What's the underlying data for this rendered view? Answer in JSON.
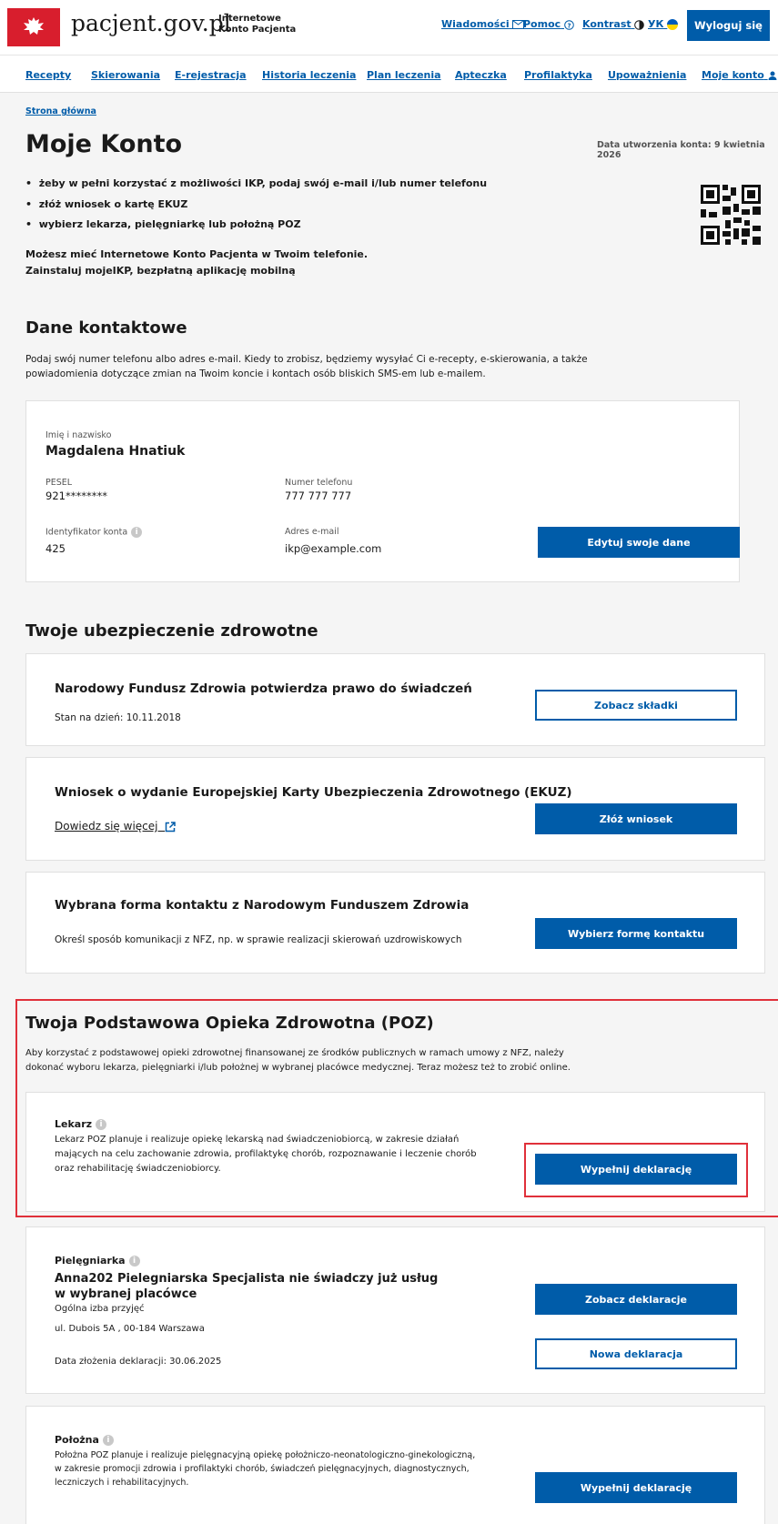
{
  "header": {
    "site_name": "pacjent.gov.pl",
    "subtitle_line1": "Internetowe",
    "subtitle_line2": "Konto Pacjenta",
    "messages": "Wiadomości",
    "help": "Pomoc",
    "contrast": "Kontrast",
    "lang": "УК",
    "logout": "Wyloguj się"
  },
  "nav": [
    {
      "label": "Recepty"
    },
    {
      "label": "Skierowania"
    },
    {
      "label": "E-rejestracja"
    },
    {
      "label": "Historia leczenia"
    },
    {
      "label": "Plan leczenia"
    },
    {
      "label": "Apteczka"
    },
    {
      "label": "Profilaktyka"
    },
    {
      "label": "Upoważnienia"
    },
    {
      "label": "Moje konto"
    }
  ],
  "breadcrumb": "Strona główna",
  "page_title": "Moje Konto",
  "created": "Data utworzenia konta: 9 kwietnia 2026",
  "bullets": [
    "żeby w pełni korzystać z możliwości IKP, podaj swój e-mail i/lub numer telefonu",
    "złóż wniosek o kartę EKUZ",
    "wybierz lekarza, pielęgniarkę lub położną POZ"
  ],
  "app_promo": {
    "line1": "Możesz mieć Internetowe Konto Pacjenta w Twoim telefonie.",
    "line2": "Zainstaluj mojeIKP, bezpłatną aplikację mobilną"
  },
  "contact": {
    "title": "Dane kontaktowe",
    "desc1": "Podaj swój numer telefonu albo adres e-mail. Kiedy to zrobisz, będziemy wysyłać Ci e-recepty, e-skierowania, a także",
    "desc2": "powiadomienia dotyczące zmian na Twoim koncie i kontach osób bliskich SMS-em lub e-mailem.",
    "name_label": "Imię i nazwisko",
    "name": "Magdalena Hnatiuk",
    "pesel_label": "PESEL",
    "pesel": "921********",
    "phone_label": "Numer telefonu",
    "phone": "777 777 777",
    "id_label": "Identyfikator konta",
    "id": "425",
    "email_label": "Adres e-mail",
    "email": "ikp@example.com",
    "edit_button": "Edytuj swoje dane"
  },
  "insurance": {
    "title": "Twoje ubezpieczenie zdrowotne",
    "nfz_title": "Narodowy Fundusz Zdrowia potwierdza prawo do świadczeń",
    "nfz_date": "Stan na dzień: 10.11.2018",
    "nfz_button": "Zobacz składki",
    "ekuz_title": "Wniosek o wydanie Europejskiej Karty Ubezpieczenia Zdrowotnego (EKUZ)",
    "ekuz_link": "Dowiedz się więcej",
    "ekuz_button": "Złóż wniosek",
    "form_title": "Wybrana forma kontaktu z Narodowym Funduszem Zdrowia",
    "form_text": "Określ sposób komunikacji z NFZ, np. w sprawie realizacji skierowań uzdrowiskowych",
    "form_button": "Wybierz formę kontaktu"
  },
  "poz": {
    "title": "Twoja Podstawowa Opieka Zdrowotna (POZ)",
    "desc1": "Aby korzystać z podstawowej opieki zdrowotnej finansowanej ze środków publicznych w ramach umowy z NFZ, należy",
    "desc2": "dokonać wyboru lekarza, pielęgniarki i/lub położnej w wybranej placówce medycznej. Teraz możesz też to zrobić online.",
    "doctor_label": "Lekarz",
    "doctor_text1": "Lekarz POZ planuje i realizuje opiekę lekarską nad świadczeniobiorcą, w zakresie działań",
    "doctor_text2": "mających na celu zachowanie zdrowia, profilaktykę chorób, rozpoznawanie i leczenie chorób",
    "doctor_text3": "oraz rehabilitację świadczeniobiorcy.",
    "doctor_button": "Wypełnij deklarację",
    "nurse_label": "Pielęgniarka",
    "nurse_name1": "Anna202 Pielegniarska Specjalista nie świadczy już usług",
    "nurse_name2": "w wybranej placówce",
    "nurse_place": "Ogólna izba przyjęć",
    "nurse_address": "ul. Dubois 5A , 00-184 Warszawa",
    "nurse_date": "Data złożenia deklaracji: 30.06.2025",
    "nurse_button1": "Zobacz deklaracje",
    "nurse_button2": "Nowa deklaracja",
    "midwife_label": "Położna",
    "midwife_text1": "Położna POZ planuje i realizuje pielęgnacyjną opiekę położniczo-neonatologiczno-ginekologiczną,",
    "midwife_text2": "w zakresie promocji zdrowia i profilaktyki chorób, świadczeń pielęgnacyjnych, diagnostycznych,",
    "midwife_text3": "leczniczych i rehabilitacyjnych.",
    "midwife_button": "Wypełnij deklarację"
  }
}
